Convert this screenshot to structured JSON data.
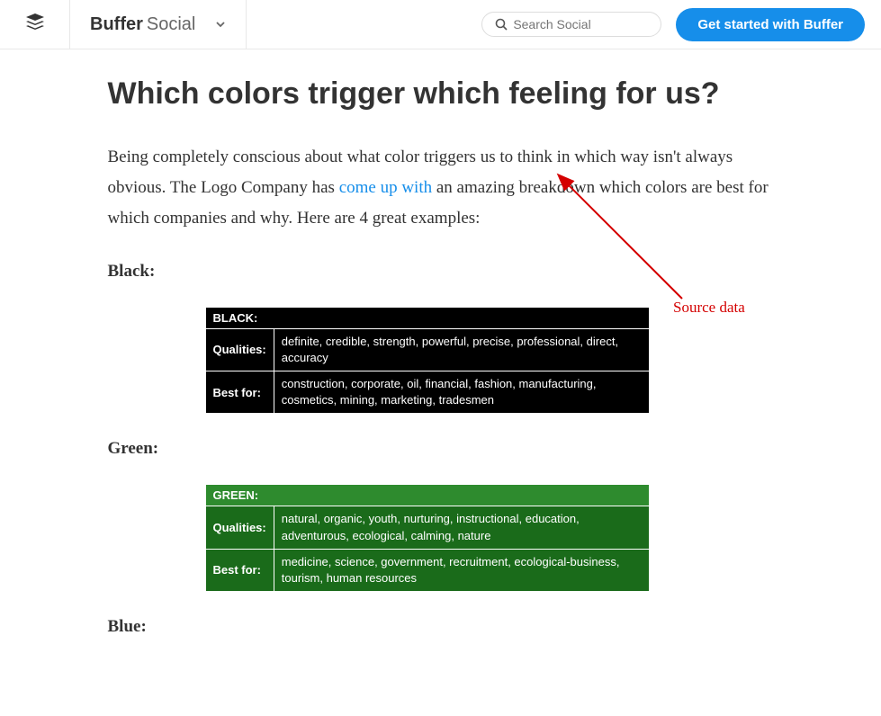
{
  "header": {
    "brand_strong": "Buffer",
    "brand_light": "Social",
    "search_placeholder": "Search Social",
    "cta_label": "Get started with Buffer"
  },
  "article": {
    "heading": "Which colors trigger which feeling for us?",
    "intro_part1": "Being completely conscious about what color triggers us to think in which way isn't always obvious. The Logo Company has ",
    "intro_link": "come up with",
    "intro_part2": " an amazing breakdown which colors are best for which companies and why. Here are 4 great examples:"
  },
  "sections": {
    "black": {
      "label": "Black:",
      "table_header": "BLACK:",
      "qualities_label": "Qualities:",
      "qualities_value": "definite, credible, strength, powerful, precise, professional, direct, accuracy",
      "bestfor_label": "Best for:",
      "bestfor_value": "construction, corporate, oil, financial, fashion, manufacturing, cosmetics, mining, marketing, tradesmen"
    },
    "green": {
      "label": "Green:",
      "table_header": "GREEN:",
      "qualities_label": "Qualities:",
      "qualities_value": "natural, organic, youth, nurturing, instructional, education, adventurous, ecological, calming, nature",
      "bestfor_label": "Best for:",
      "bestfor_value": "medicine, science, government, recruitment, ecological-business, tourism, human resources"
    },
    "blue": {
      "label": "Blue:"
    }
  },
  "annotation": {
    "text": "Source data"
  }
}
